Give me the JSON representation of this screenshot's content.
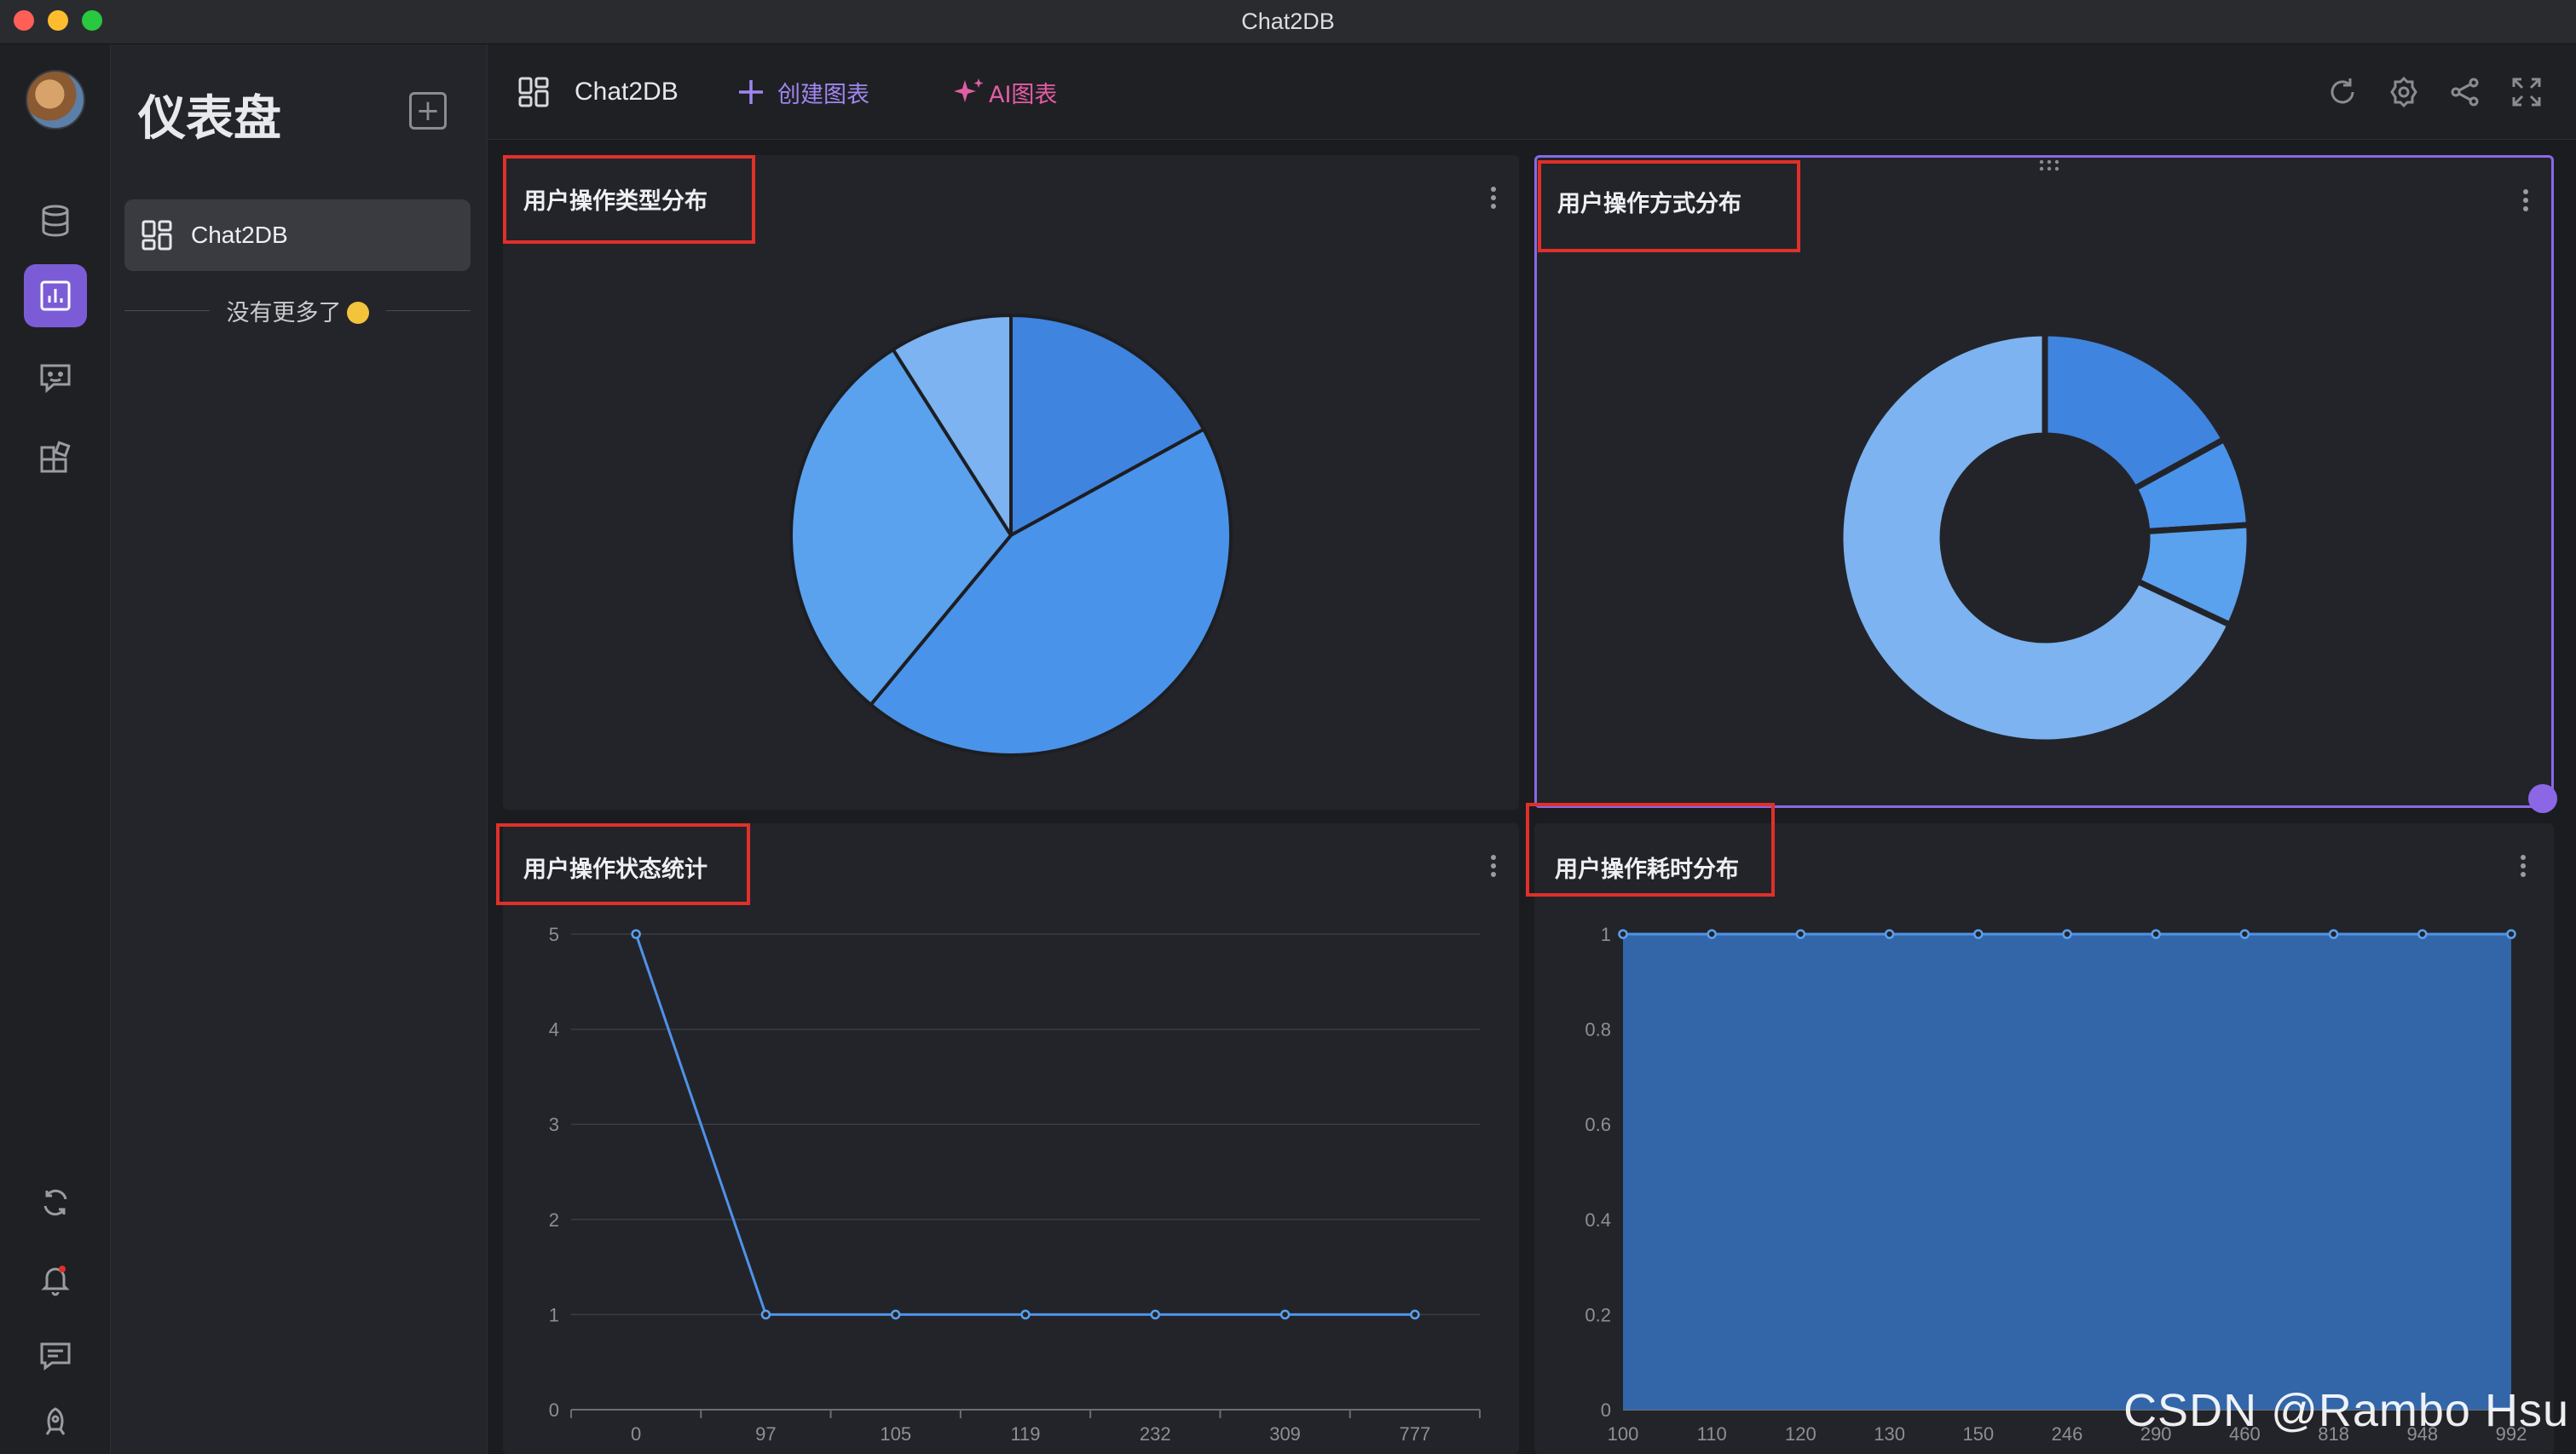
{
  "window": {
    "title": "Chat2DB"
  },
  "rail": {
    "items": [
      {
        "name": "database-icon"
      },
      {
        "name": "dashboard-icon",
        "active": true
      },
      {
        "name": "chat-bot-icon"
      },
      {
        "name": "plugins-icon"
      }
    ],
    "bottom_items": [
      {
        "name": "sync-icon"
      },
      {
        "name": "notification-icon"
      },
      {
        "name": "feedback-icon"
      },
      {
        "name": "settings-bell-icon"
      }
    ]
  },
  "sidebar": {
    "title": "仪表盘",
    "items": [
      {
        "label": "Chat2DB"
      }
    ],
    "no_more": "没有更多了"
  },
  "toolbar": {
    "dashboard_name": "Chat2DB",
    "create_chart": "创建图表",
    "ai_chart": "AI图表"
  },
  "colors": {
    "accent": "#7b5cd6",
    "pie_1": "#3f84de",
    "pie_2": "#4a93ea",
    "pie_3": "#5aa1ee",
    "pie_4": "#7cb3f0",
    "area_fill": "#3366a8",
    "highlight_box": "#e0302a"
  },
  "charts": {
    "c1": {
      "title": "用户操作类型分布"
    },
    "c2": {
      "title": "用户操作方式分布"
    },
    "c3": {
      "title": "用户操作状态统计"
    },
    "c4": {
      "title": "用户操作耗时分布"
    }
  },
  "chart_data": [
    {
      "type": "pie",
      "title": "用户操作类型分布",
      "values": [
        17,
        44,
        30,
        9
      ],
      "colors": [
        "#3f84de",
        "#4a93ea",
        "#5aa1ee",
        "#7cb3f0"
      ]
    },
    {
      "type": "pie",
      "variant": "donut",
      "title": "用户操作方式分布",
      "values": [
        17,
        7,
        8,
        68
      ],
      "colors": [
        "#3f84de",
        "#4a93ea",
        "#5aa1ee",
        "#7cb3f0"
      ]
    },
    {
      "type": "line",
      "title": "用户操作状态统计",
      "categories": [
        "0",
        "97",
        "105",
        "119",
        "232",
        "309",
        "777"
      ],
      "values": [
        5,
        1,
        1,
        1,
        1,
        1,
        1
      ],
      "ylim": [
        0,
        5
      ],
      "yticks": [
        0,
        1,
        2,
        3,
        4,
        5
      ],
      "grid": true
    },
    {
      "type": "area",
      "title": "用户操作耗时分布",
      "categories": [
        "100",
        "110",
        "120",
        "130",
        "150",
        "246",
        "290",
        "460",
        "818",
        "948",
        "992"
      ],
      "values": [
        1,
        1,
        1,
        1,
        1,
        1,
        1,
        1,
        1,
        1,
        1
      ],
      "ylim": [
        0,
        1
      ],
      "yticks": [
        "0",
        "0.2",
        "0.4",
        "0.6",
        "0.8",
        "1"
      ],
      "grid": true
    }
  ],
  "watermark": "CSDN @Rambo Hsu"
}
